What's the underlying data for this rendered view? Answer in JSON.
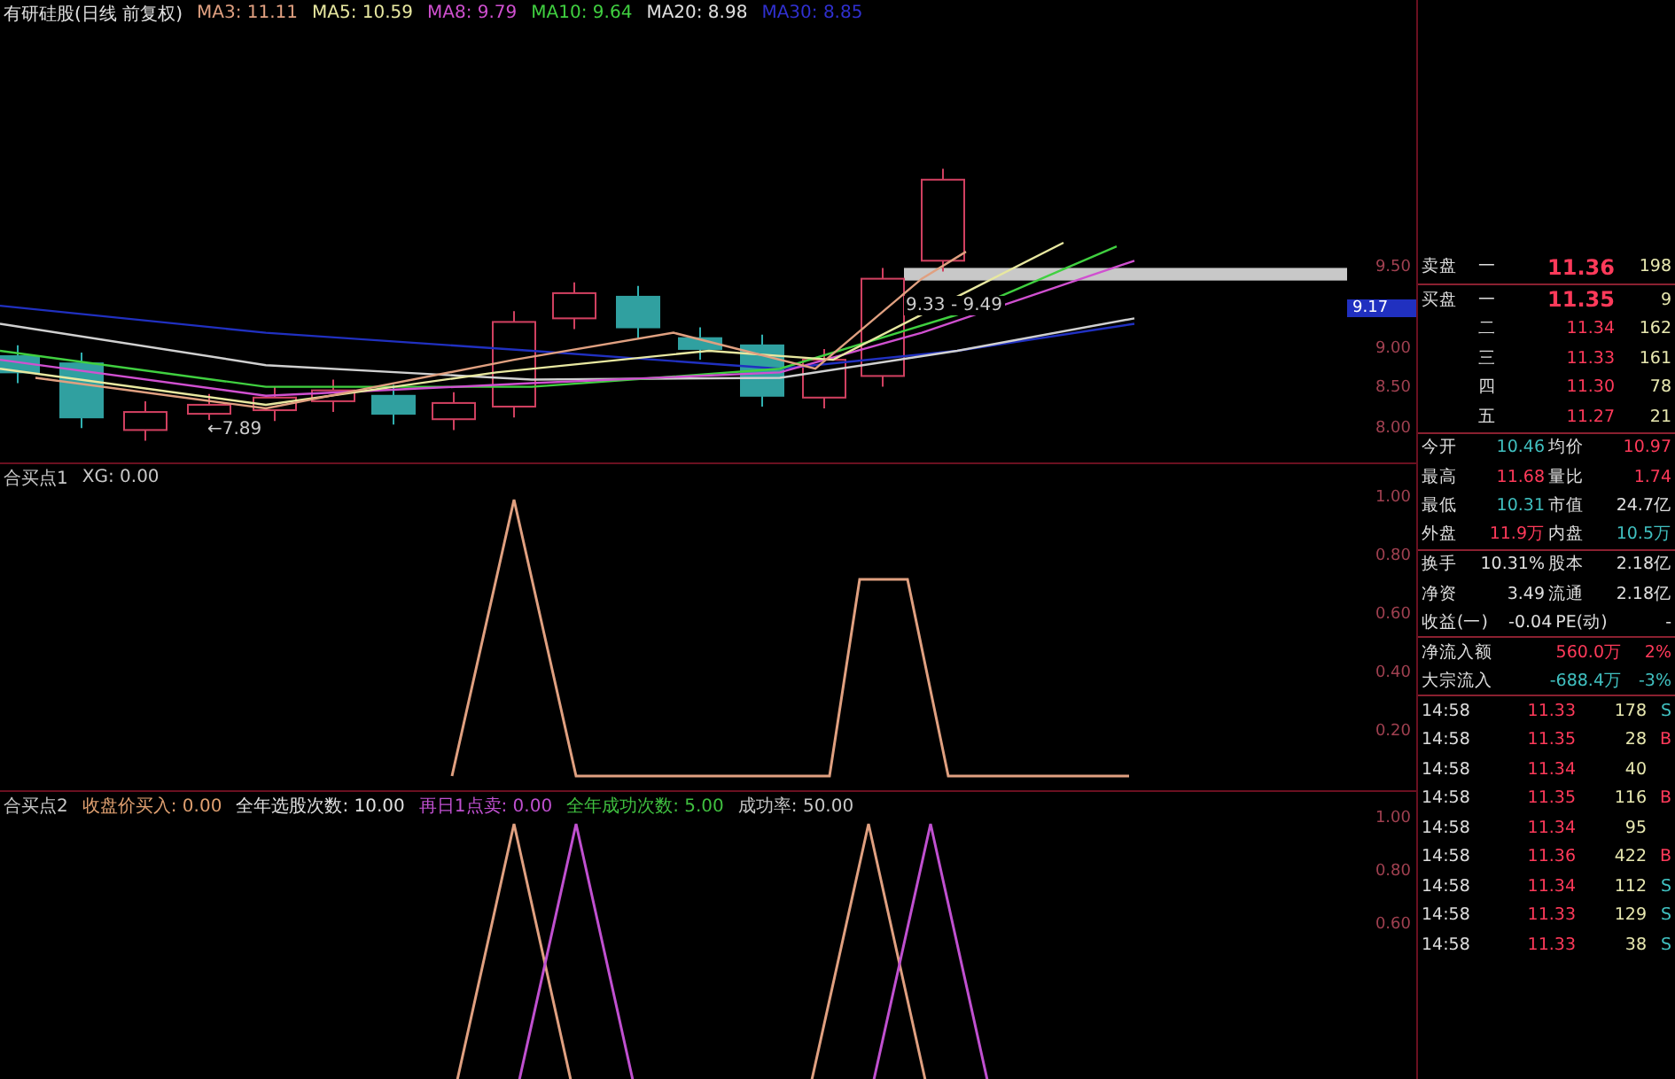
{
  "header": {
    "title": "有研硅股(日线 前复权)",
    "averages": [
      {
        "text": "MA3: 11.11",
        "color": "#e0a080"
      },
      {
        "text": "MA5: 10.59",
        "color": "#e8e8a0"
      },
      {
        "text": "MA8: 9.79",
        "color": "#d050d0"
      },
      {
        "text": "MA10: 9.64",
        "color": "#40d040"
      },
      {
        "text": "MA20: 8.98",
        "color": "#e0e0e0"
      },
      {
        "text": "MA30: 8.85",
        "color": "#3030d0"
      }
    ]
  },
  "main_chart": {
    "range_note": "9.33 - 9.49",
    "low_note": "←7.89",
    "current_price": "9.17",
    "ticks": [
      "9.50",
      "9.00",
      "8.50",
      "8.00"
    ]
  },
  "indicators": [
    {
      "title": "合买点1",
      "items": [
        {
          "text": "XG: 0.00",
          "color": "#c8c8c8"
        }
      ],
      "ticks": [
        "1.00",
        "0.80",
        "0.60",
        "0.40",
        "0.20"
      ]
    },
    {
      "title": "合买点2",
      "items": [
        {
          "text": "收盘价买入: 0.00",
          "color": "#e0a070"
        },
        {
          "text": "全年选股次数: 10.00",
          "color": "#e0e0e0"
        },
        {
          "text": "再日1点卖: 0.00",
          "color": "#c050d0"
        },
        {
          "text": "全年成功次数: 5.00",
          "color": "#40c040"
        },
        {
          "text": "成功率: 50.00",
          "color": "#c8c8c8"
        }
      ],
      "ticks": [
        "1.00",
        "0.80",
        "0.60"
      ]
    }
  ],
  "order_book": [
    {
      "side": "卖盘",
      "level": "一",
      "price": "11.36",
      "volume": "198"
    },
    {
      "side": "买盘",
      "level": "一",
      "price": "11.35",
      "volume": "9"
    },
    {
      "level": "二",
      "price": "11.34",
      "volume": "162"
    },
    {
      "level": "三",
      "price": "11.33",
      "volume": "161"
    },
    {
      "level": "四",
      "price": "11.30",
      "volume": "78"
    },
    {
      "level": "五",
      "price": "11.27",
      "volume": "21"
    }
  ],
  "stats": [
    [
      {
        "label": "今开",
        "value": "10.46",
        "color": "#40c0c0"
      },
      {
        "label": "均价",
        "value": "10.97",
        "color": "#ff3a5a"
      }
    ],
    [
      {
        "label": "最高",
        "value": "11.68",
        "color": "#ff3a5a"
      },
      {
        "label": "量比",
        "value": "1.74",
        "color": "#ff3a5a"
      }
    ],
    [
      {
        "label": "最低",
        "value": "10.31",
        "color": "#40c0c0"
      },
      {
        "label": "市值",
        "value": "24.7亿",
        "color": "#e0e0e0"
      }
    ],
    [
      {
        "label": "外盘",
        "value": "11.9万",
        "color": "#ff3a5a"
      },
      {
        "label": "内盘",
        "value": "10.5万",
        "color": "#40c0c0"
      }
    ],
    [
      {
        "label": "换手",
        "value": "10.31%",
        "color": "#e0e0e0"
      },
      {
        "label": "股本",
        "value": "2.18亿",
        "color": "#e0e0e0"
      }
    ],
    [
      {
        "label": "净资",
        "value": "3.49",
        "color": "#e0e0e0"
      },
      {
        "label": "流通",
        "value": "2.18亿",
        "color": "#e0e0e0"
      }
    ],
    [
      {
        "label": "收益(一)",
        "value": "-0.04",
        "color": "#e0e0e0"
      },
      {
        "label": "PE(动)",
        "value": "-",
        "color": "#e0e0e0"
      }
    ]
  ],
  "flows": [
    {
      "label": "净流入额",
      "value": "560.0万",
      "pct": "2%",
      "color": "#ff3a5a"
    },
    {
      "label": "大宗流入",
      "value": "-688.4万",
      "pct": "-3%",
      "color": "#40c0c0"
    }
  ],
  "trades": [
    {
      "time": "14:58",
      "price": "11.33",
      "volume": "178",
      "side": "S"
    },
    {
      "time": "14:58",
      "price": "11.35",
      "volume": "28",
      "side": "B"
    },
    {
      "time": "14:58",
      "price": "11.34",
      "volume": "40"
    },
    {
      "time": "14:58",
      "price": "11.35",
      "volume": "116",
      "side": "B"
    },
    {
      "time": "14:58",
      "price": "11.34",
      "volume": "95"
    },
    {
      "time": "14:58",
      "price": "11.36",
      "volume": "422",
      "side": "B"
    },
    {
      "time": "14:58",
      "price": "11.34",
      "volume": "112",
      "side": "S"
    },
    {
      "time": "14:58",
      "price": "11.33",
      "volume": "129",
      "side": "S"
    },
    {
      "time": "14:58",
      "price": "11.33",
      "volume": "38",
      "side": "S"
    }
  ]
}
